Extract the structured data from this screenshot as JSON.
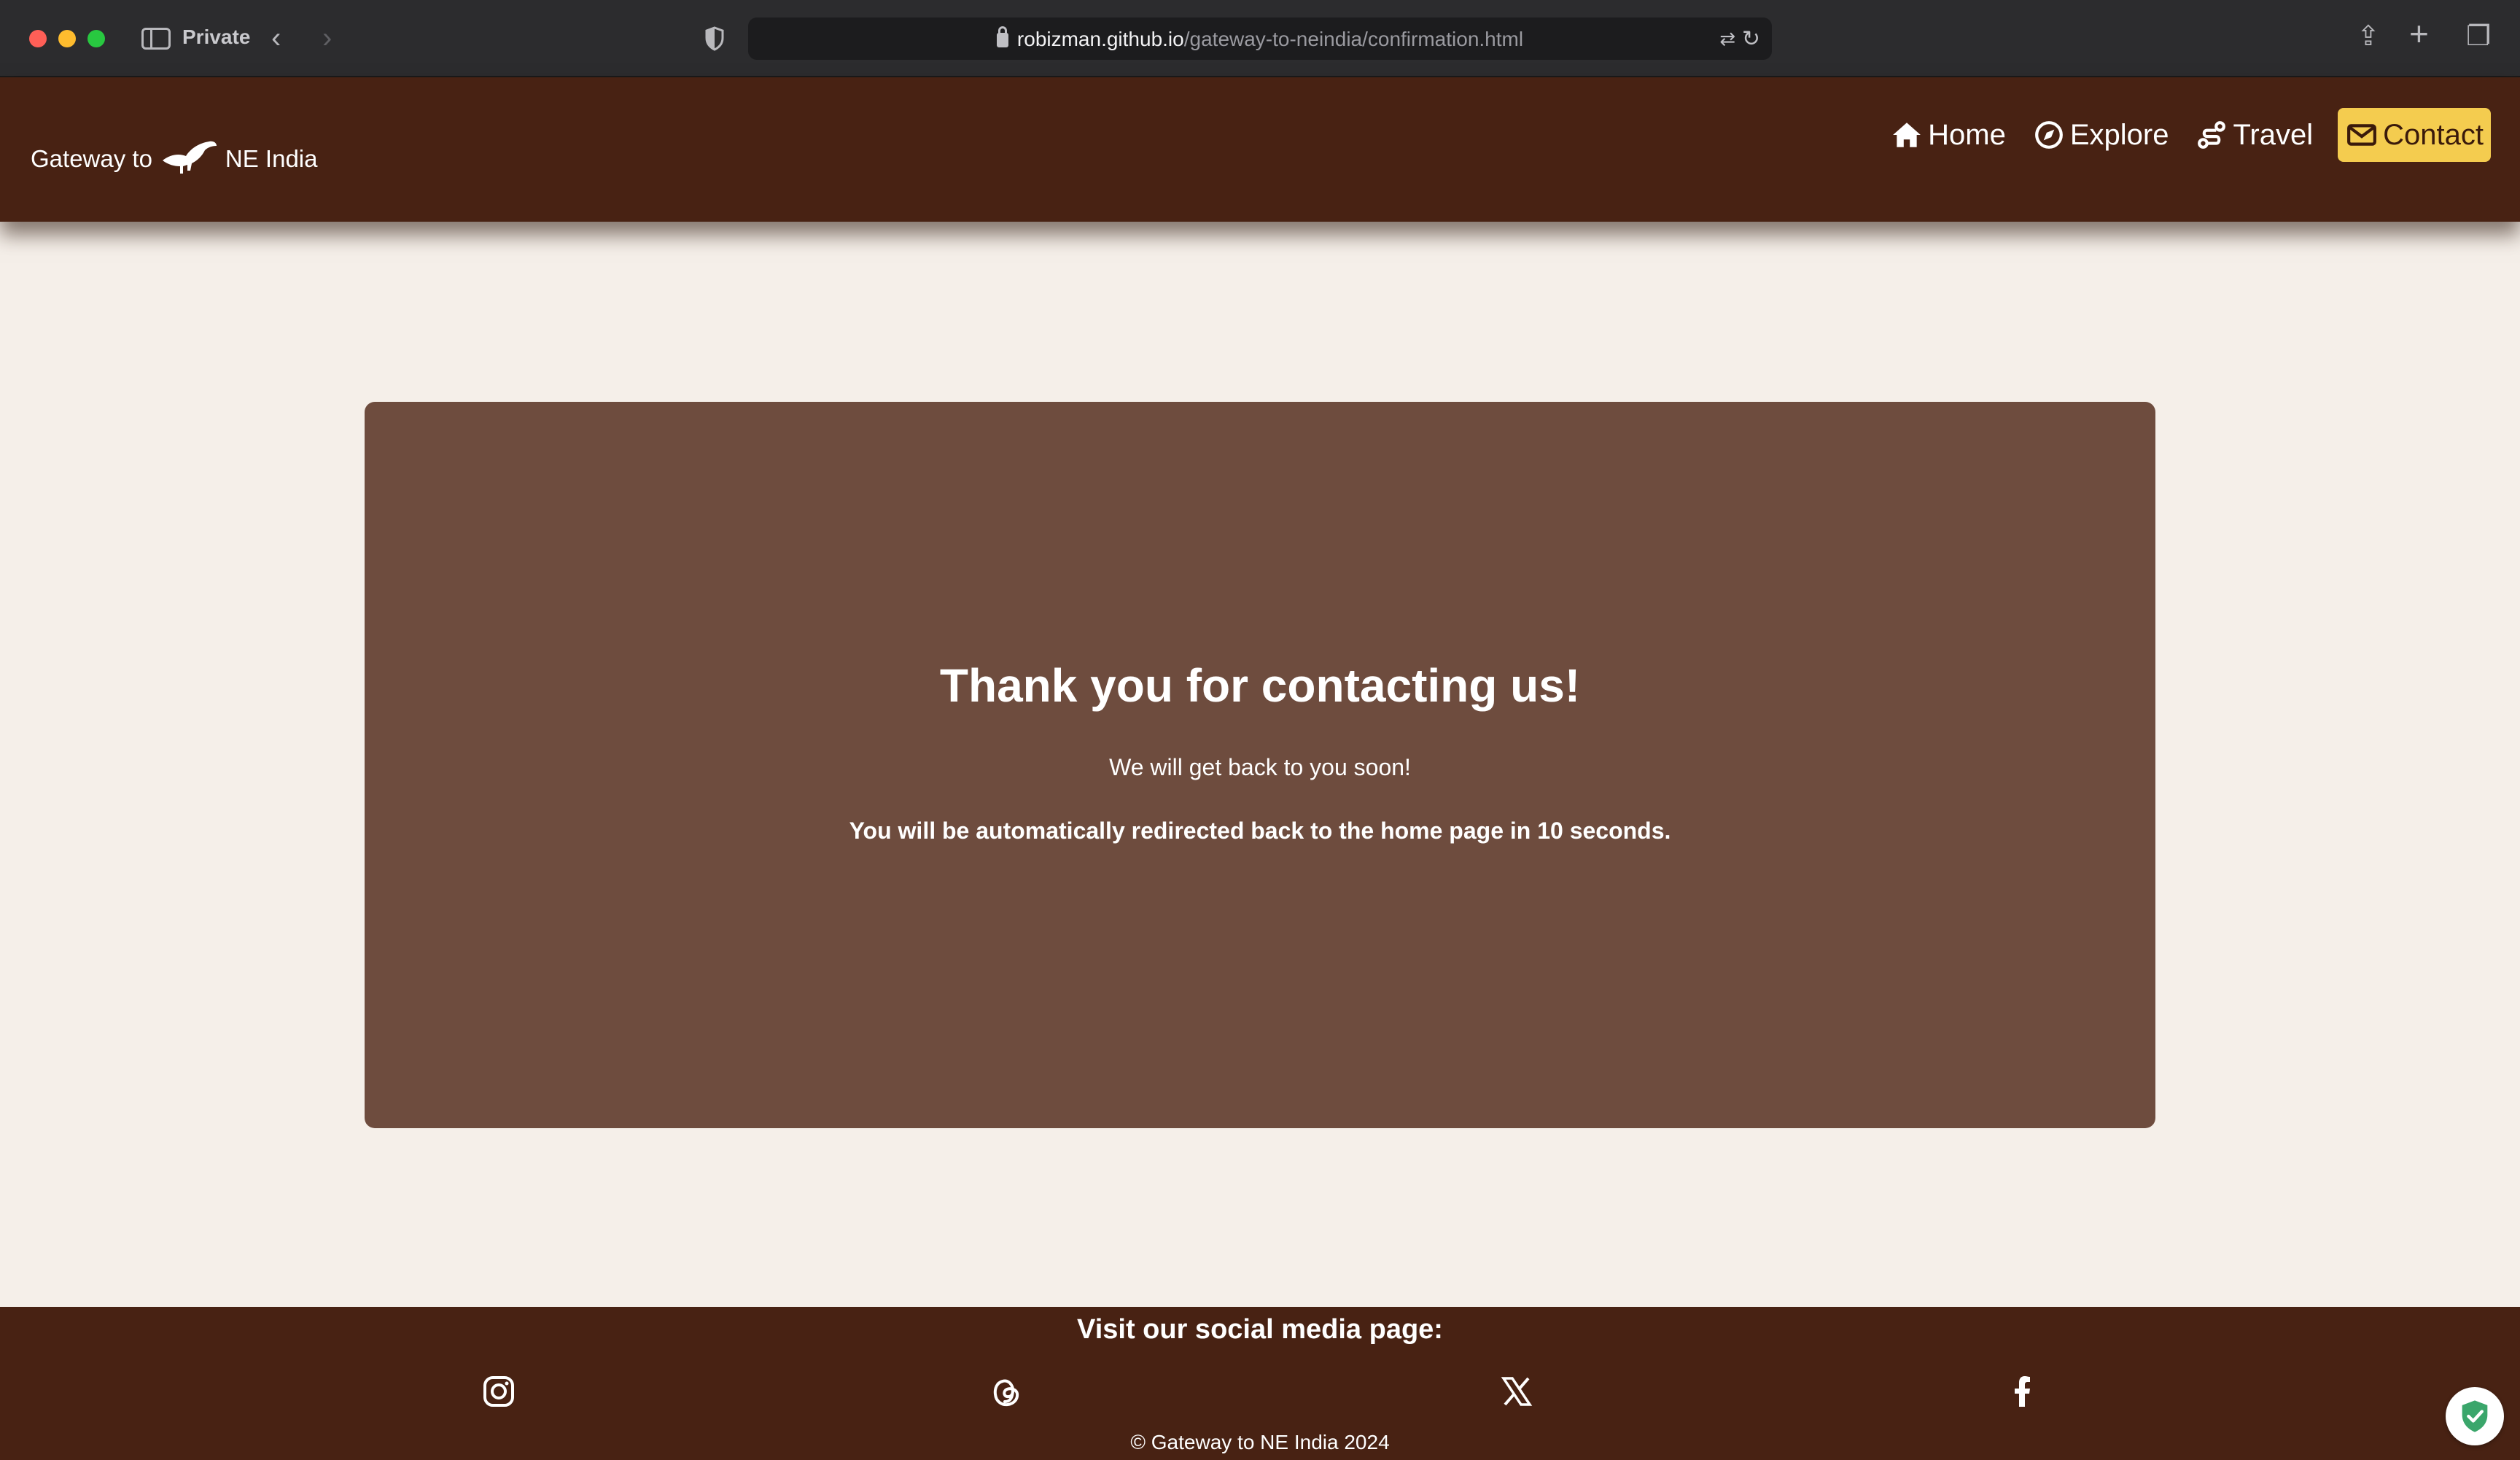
{
  "browser": {
    "private_label": "Private",
    "url_host": "robizman.github.io",
    "url_path": "/gateway-to-neindia/confirmation.html"
  },
  "header": {
    "brand_prefix": "Gateway to",
    "brand_suffix": "NE India",
    "nav": {
      "home": "Home",
      "explore": "Explore",
      "travel": "Travel",
      "contact": "Contact"
    },
    "colors": {
      "bar": "#482213",
      "active_pill": "#f4cc4f"
    }
  },
  "main": {
    "title": "Thank you for contacting us!",
    "message": "We will get back to you soon!",
    "redirect_notice": "You will be automatically redirected back to the home page in 10 seconds.",
    "card_color": "#6e4c3e",
    "page_bg": "#f5efe9"
  },
  "footer": {
    "heading": "Visit our social media page:",
    "social_icons": [
      "instagram-icon",
      "threads-icon",
      "x-icon",
      "facebook-icon"
    ],
    "copyright": "© Gateway to NE India 2024"
  }
}
